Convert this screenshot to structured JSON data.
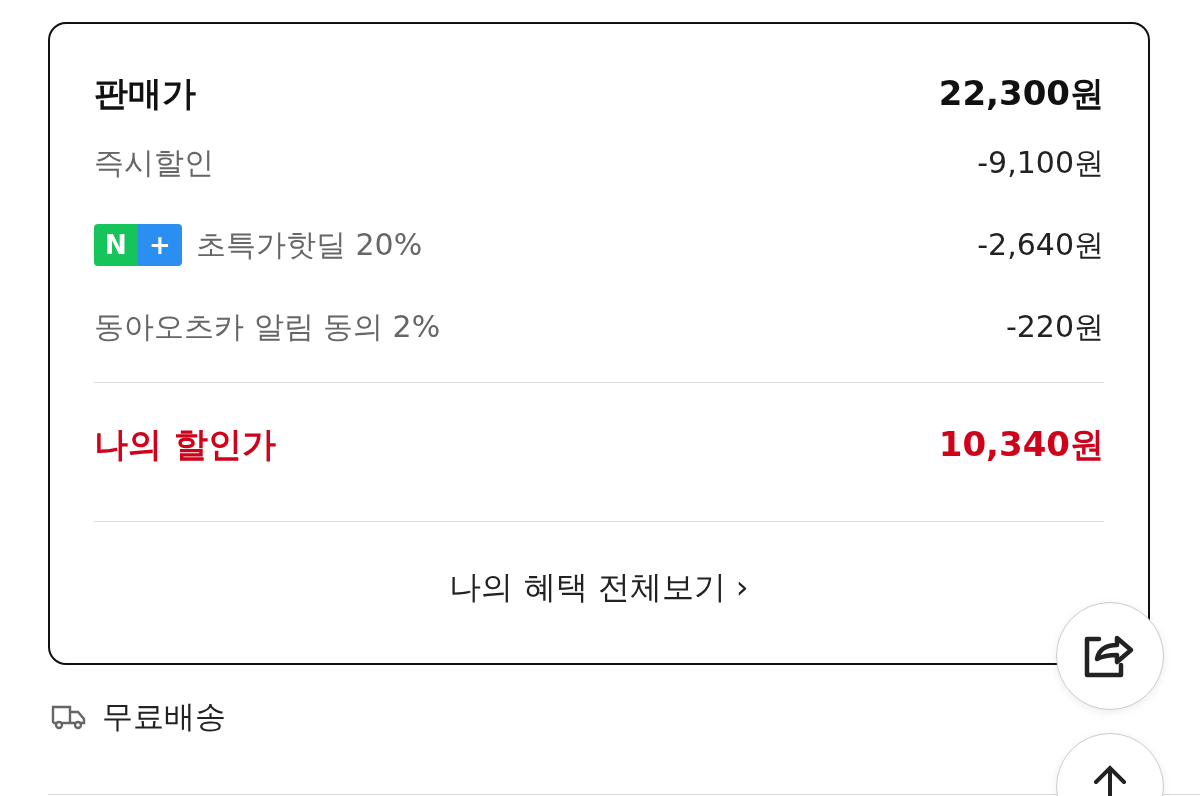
{
  "price_card": {
    "header": {
      "label": "판매가",
      "value": "22,300원"
    },
    "discounts": [
      {
        "kind": "plain",
        "label": "즉시할인",
        "value": "-9,100원"
      },
      {
        "kind": "badge",
        "badge": {
          "left": "N",
          "right": "+"
        },
        "label": "초특가핫딜 20%",
        "value": "-2,640원"
      },
      {
        "kind": "plain",
        "label": "동아오츠카 알림 동의 2%",
        "value": "-220원"
      }
    ],
    "total": {
      "label": "나의 할인가",
      "value": "10,340원"
    },
    "link": {
      "label": "나의 혜택 전체보기",
      "arrow": "›"
    }
  },
  "shipping": {
    "label": "무료배송"
  }
}
